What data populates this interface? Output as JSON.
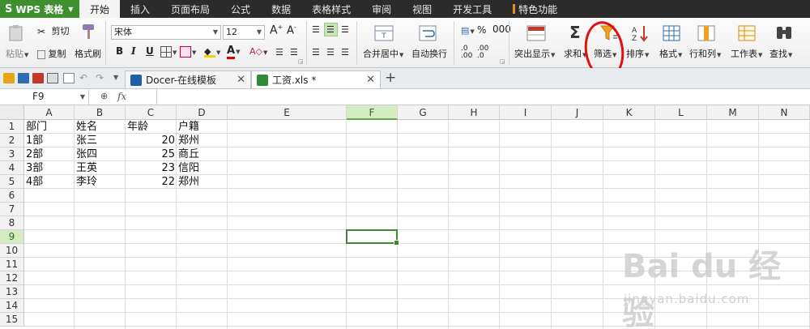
{
  "menubar": {
    "app_name": "WPS 表格",
    "tabs": [
      "开始",
      "插入",
      "页面布局",
      "公式",
      "数据",
      "表格样式",
      "审阅",
      "视图",
      "开发工具",
      "特色功能"
    ],
    "active_tab": "开始"
  },
  "ribbon": {
    "clipboard": {
      "paste": "粘贴",
      "cut": "剪切",
      "copy": "复制",
      "format_painter": "格式刷"
    },
    "font": {
      "name": "宋体",
      "size": "12",
      "bold": "B",
      "italic": "I",
      "underline": "U"
    },
    "merge_center": "合并居中",
    "wrap_text": "自动换行",
    "number_format": {
      "percent": "%",
      "comma": "000"
    },
    "highlight": "突出显示",
    "sum": "求和",
    "filter": "筛选",
    "sort": "排序",
    "format": "格式",
    "rows_cols": "行和列",
    "worksheet": "工作表",
    "find": "查找"
  },
  "quick_access": {
    "tabs": [
      {
        "label": "Docer-在线模板",
        "icon": "docer-icon"
      },
      {
        "label": "工资.xls *",
        "icon": "excel-icon"
      }
    ],
    "new_tab": "+"
  },
  "formula_bar": {
    "name_box": "F9",
    "fx": "fx",
    "content": ""
  },
  "grid": {
    "columns": [
      "A",
      "B",
      "C",
      "D",
      "E",
      "F",
      "G",
      "H",
      "I",
      "J",
      "K",
      "L",
      "M",
      "N"
    ],
    "rows": [
      "1",
      "2",
      "3",
      "4",
      "5",
      "6",
      "7",
      "8",
      "9",
      "10",
      "11",
      "12",
      "13",
      "14",
      "15"
    ],
    "selected_column": "F",
    "selected_row": "9",
    "header": [
      "部门",
      "姓名",
      "年龄",
      "户籍"
    ],
    "data": [
      [
        "1部",
        "张三",
        "20",
        "郑州"
      ],
      [
        "2部",
        "张四",
        "25",
        "商丘"
      ],
      [
        "3部",
        "王英",
        "23",
        "信阳"
      ],
      [
        "4部",
        "李玲",
        "22",
        "郑州"
      ]
    ]
  },
  "watermark": {
    "brand": "Bai du 经验",
    "url": "jingyan.baidu.com"
  },
  "colors": {
    "accent_green": "#3e8f2e",
    "annotation_red": "#e01010"
  }
}
